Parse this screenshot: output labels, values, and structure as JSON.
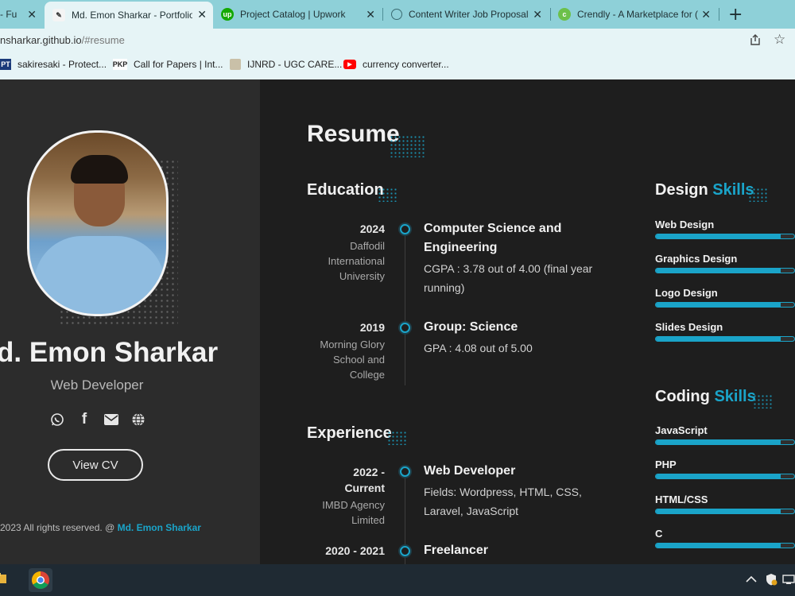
{
  "browser": {
    "tabs": [
      {
        "title": "- Fu",
        "icon": "generic-icon",
        "active": false
      },
      {
        "title": "Md. Emon Sharkar - Portfolio",
        "icon": "portfolio-favicon",
        "active": true
      },
      {
        "title": "Project Catalog | Upwork",
        "icon": "upwork-icon",
        "active": false
      },
      {
        "title": "Content Writer Job Proposal",
        "icon": "chatgpt-icon",
        "active": false
      },
      {
        "title": "Crendly - A Marketplace for (",
        "icon": "crendly-icon",
        "active": false
      }
    ],
    "new_tab": "+",
    "close_glyph": "✕",
    "url": {
      "host": "nsharkar.github.io",
      "path": "/#resume"
    },
    "bookmarks": [
      {
        "label": "sakiresaki - Protect...",
        "icon_text": "PT"
      },
      {
        "label": "Call for Papers | Int...",
        "icon_text": "PKP"
      },
      {
        "label": "IJNRD - UGC CARE...",
        "icon_text": ""
      },
      {
        "label": "currency converter...",
        "icon_text": ""
      }
    ]
  },
  "profile": {
    "name": "d. Emon Sharkar",
    "role": "Web Developer",
    "cv_button": "View CV",
    "copyright_prefix": "2023 All rights reserved. @ ",
    "copyright_name": "Md. Emon Sharkar",
    "social": [
      "whatsapp-icon",
      "facebook-icon",
      "mail-icon",
      "globe-icon"
    ]
  },
  "resume": {
    "title": "Resume",
    "education": {
      "heading": "Education",
      "items": [
        {
          "year": "2024",
          "institution": "Daffodil International University",
          "title": "Computer Science and Engineering",
          "desc": "CGPA : 3.78 out of 4.00 (final year running)"
        },
        {
          "year": "2019",
          "institution": "Morning Glory School and College",
          "title": "Group: Science",
          "desc": "GPA : 4.08 out of 5.00"
        }
      ]
    },
    "experience": {
      "heading": "Experience",
      "items": [
        {
          "year": "2022 - Current",
          "institution": "IMBD Agency Limited",
          "title": "Web Developer",
          "desc": "Fields: Wordpress, HTML, CSS, Laravel, JavaScript"
        },
        {
          "year": "2020 - 2021",
          "institution": "",
          "title": "Freelancer",
          "desc": ""
        }
      ]
    },
    "design_skills": {
      "heading_a": "Design",
      "heading_b": "Skills",
      "items": [
        {
          "name": "Web Design",
          "level": 0.9
        },
        {
          "name": "Graphics Design",
          "level": 0.9
        },
        {
          "name": "Logo Design",
          "level": 0.9
        },
        {
          "name": "Slides Design",
          "level": 0.9
        }
      ]
    },
    "coding_skills": {
      "heading_a": "Coding",
      "heading_b": "Skills",
      "items": [
        {
          "name": "JavaScript",
          "level": 0.9
        },
        {
          "name": "PHP",
          "level": 0.9
        },
        {
          "name": "HTML/CSS",
          "level": 0.9
        },
        {
          "name": "C",
          "level": 0.9
        }
      ]
    }
  },
  "colors": {
    "accent": "#1aa4c9",
    "left_panel": "#2c2c2c",
    "main_bg": "#1e1e1e",
    "tabstrip": "#8ed0d8"
  }
}
